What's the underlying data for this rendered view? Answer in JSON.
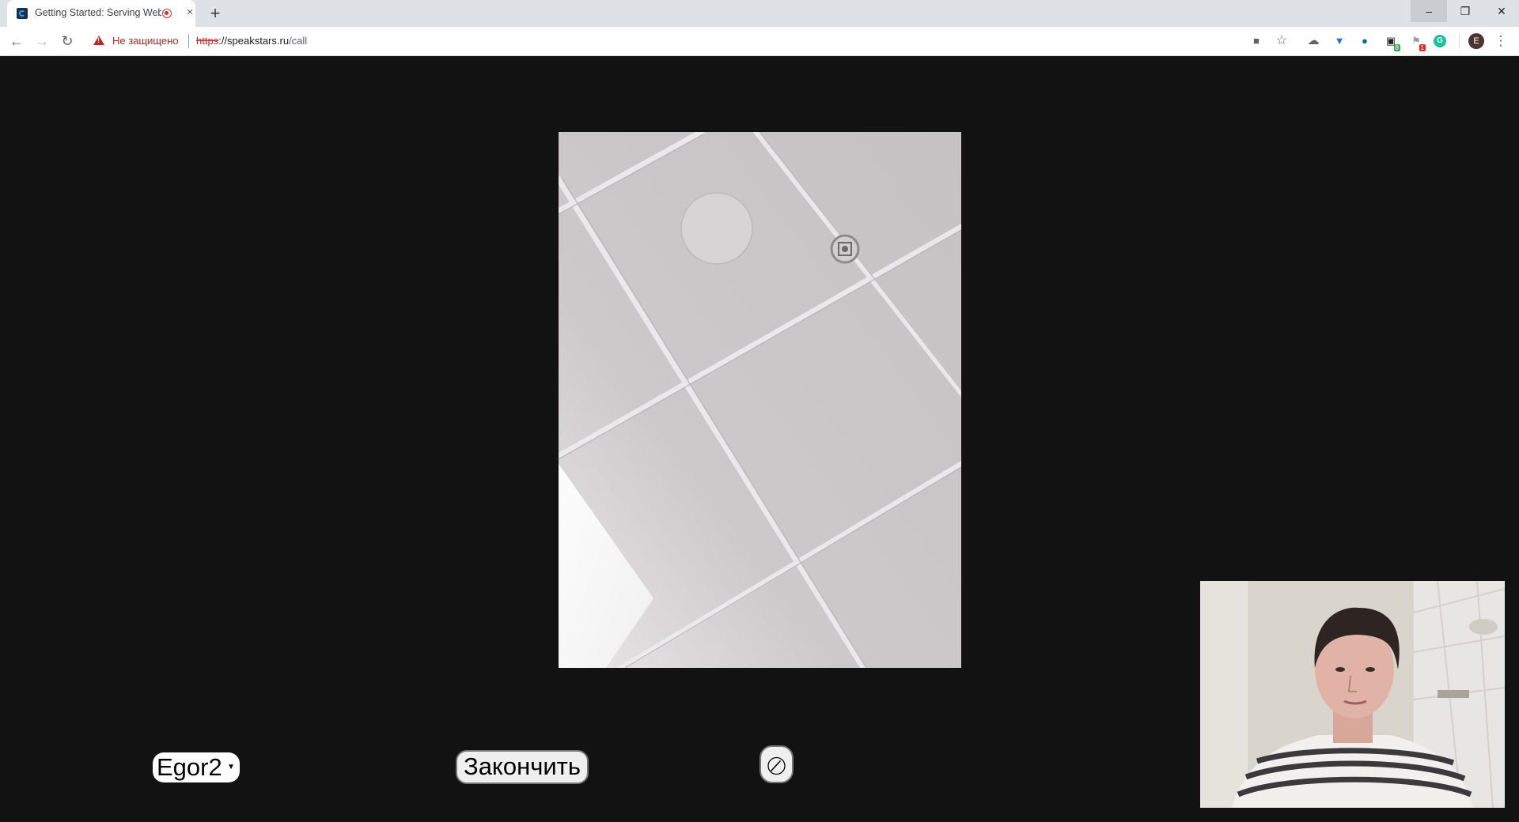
{
  "browser": {
    "tab": {
      "title": "Getting Started: Serving Web Content",
      "close_glyph": "×"
    },
    "new_tab_glyph": "+",
    "window_controls": {
      "minimize": "–",
      "restore": "❐",
      "close": "✕"
    },
    "nav": {
      "back": "←",
      "forward": "→",
      "reload": "↻"
    },
    "omnibox": {
      "security_label": "Не защищено",
      "url_scheme": "https",
      "url_host": "://speakstars.ru",
      "url_path": "/call"
    },
    "extensions": [
      {
        "icon": "camera-icon",
        "glyph": "■"
      },
      {
        "icon": "star-icon",
        "glyph": "☆"
      },
      {
        "icon": "cloud-icon",
        "glyph": "☁"
      },
      {
        "icon": "pocket-icon",
        "glyph": "▼"
      },
      {
        "icon": "owl-icon",
        "glyph": "●"
      },
      {
        "icon": "calendar-icon",
        "glyph": "▣",
        "badge": "8",
        "badge_color": "#34a853"
      },
      {
        "icon": "flag-icon",
        "glyph": "⚑",
        "badge": "1",
        "badge_color": "#d93025"
      },
      {
        "icon": "grammarly-icon",
        "glyph": "G"
      }
    ],
    "profile_initial": "E",
    "menu_glyph": "⋮"
  },
  "call": {
    "user_select": {
      "value": "Egor2"
    },
    "end_button_label": "Закончить"
  },
  "colors": {
    "page_background": "#121212",
    "warning_red": "#c5221f"
  }
}
